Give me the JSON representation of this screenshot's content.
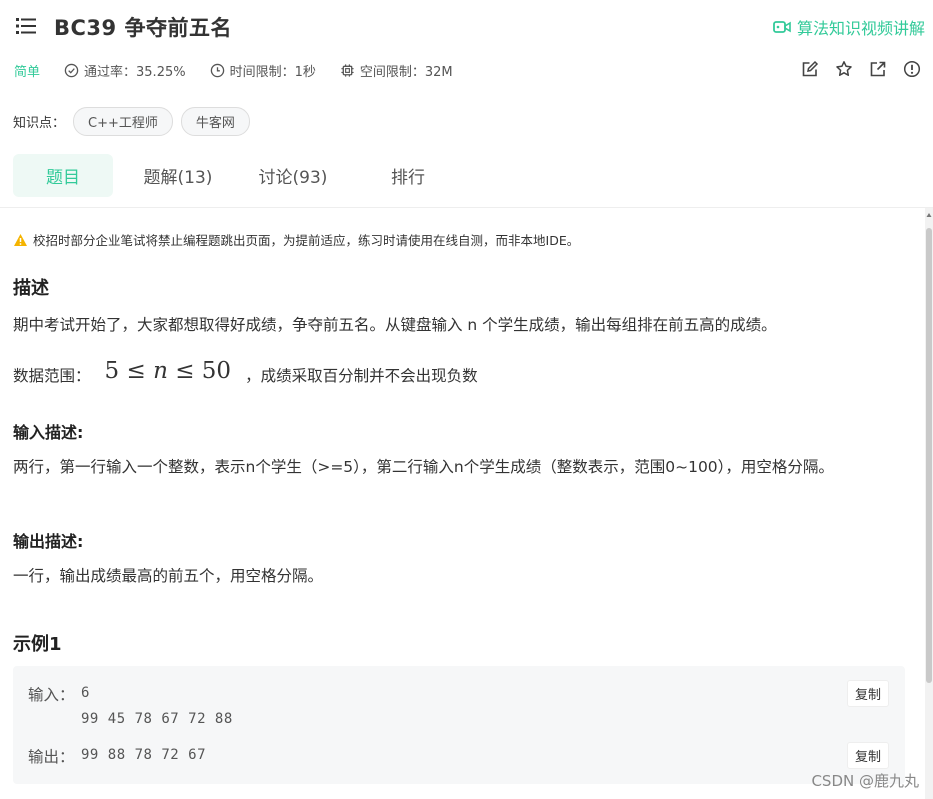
{
  "header": {
    "title": "BC39  争夺前五名",
    "video_link": "算法知识视频讲解"
  },
  "meta": {
    "difficulty": "简单",
    "pass_rate": "通过率：35.25%",
    "time_limit": "时间限制：1秒",
    "memory_limit": "空间限制：32M"
  },
  "tags": {
    "label": "知识点：",
    "items": [
      "C++工程师",
      "牛客网"
    ]
  },
  "tabs": [
    {
      "label": "题目",
      "active": true
    },
    {
      "label": "题解(13)",
      "active": false
    },
    {
      "label": "讨论(93)",
      "active": false
    },
    {
      "label": "排行",
      "active": false
    }
  ],
  "content": {
    "notice": "校招时部分企业笔试将禁止编程题跳出页面，为提前适应，练习时请使用在线自测，而非本地IDE。",
    "desc_heading": "描述",
    "desc_text": "期中考试开始了，大家都想取得好成绩，争夺前五名。从键盘输入 n 个学生成绩，输出每组排在前五高的成绩。",
    "range_label": "数据范围：",
    "range_math": {
      "low": "5",
      "var": "n",
      "high": "50"
    },
    "range_suffix": "，成绩采取百分制并不会出现负数",
    "input_heading": "输入描述:",
    "input_text": "两行，第一行输入一个整数，表示n个学生（>=5），第二行输入n个学生成绩（整数表示，范围0~100），用空格分隔。",
    "output_heading": "输出描述:",
    "output_text": "一行，输出成绩最高的前五个，用空格分隔。",
    "example_heading": "示例1",
    "example": {
      "input_label": "输入：",
      "input_value": "6\n99 45 78 67 72 88",
      "output_label": "输出：",
      "output_value": "99 88 78 72 67",
      "copy_label": "复制"
    }
  },
  "watermark": "CSDN @鹿九丸",
  "colors": {
    "accent": "#32ca99",
    "warning": "#f5b400",
    "code_bg": "#f6f7f8"
  }
}
